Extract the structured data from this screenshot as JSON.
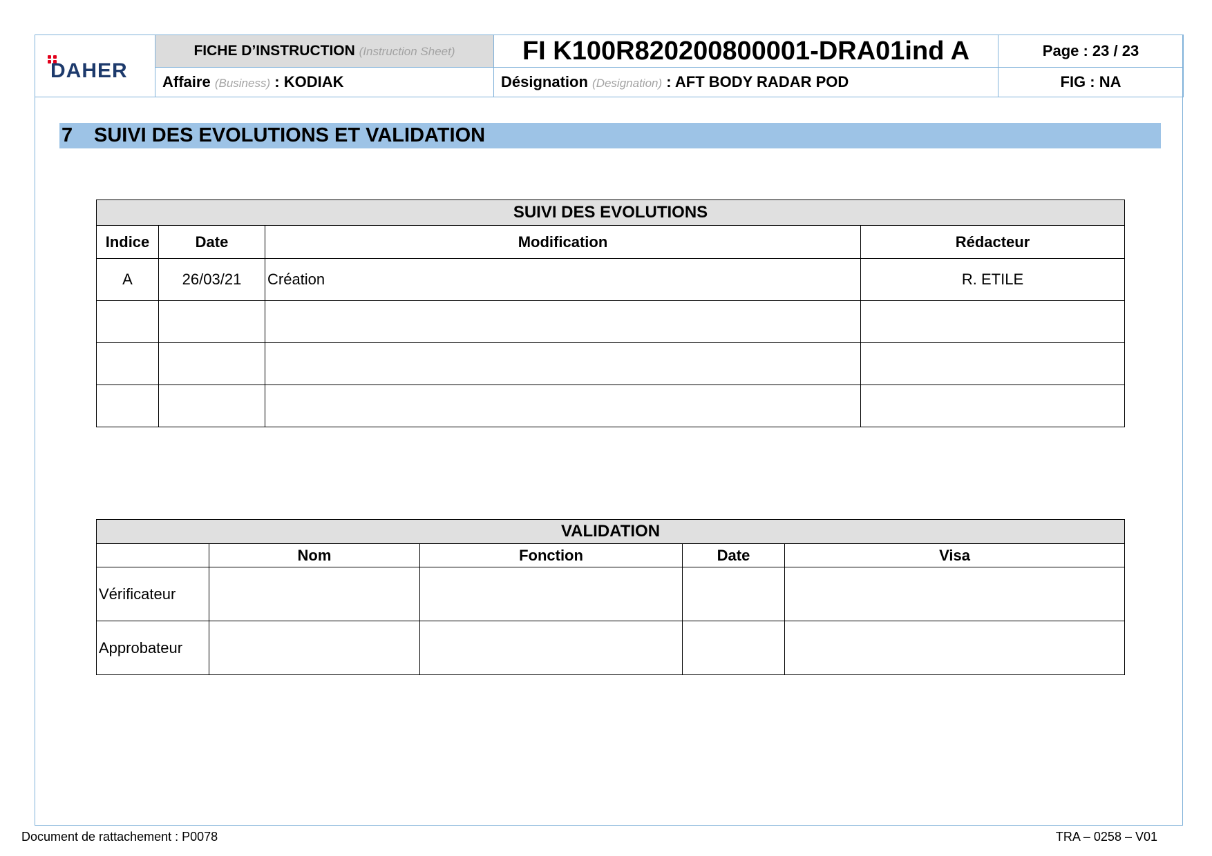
{
  "header": {
    "logo_text": "DAHER",
    "sheet_label": "FICHE D’INSTRUCTION",
    "sheet_label_en": "(Instruction Sheet)",
    "document_ref": "FI K100R820200800001-DRA01ind A",
    "page": "Page : 23 / 23",
    "affaire_label": "Affaire",
    "affaire_label_en": "(Business)",
    "affaire_value": ": KODIAK",
    "designation_label": "Désignation",
    "designation_label_en": "(Designation)",
    "designation_value": ":  AFT BODY RADAR POD",
    "fig": "FIG : NA"
  },
  "section": {
    "number": "7",
    "title": "SUIVI DES EVOLUTIONS ET VALIDATION"
  },
  "evolutions": {
    "title": "SUIVI DES EVOLUTIONS",
    "columns": [
      "Indice",
      "Date",
      "Modification",
      "Rédacteur"
    ],
    "rows": [
      [
        "A",
        "26/03/21",
        "Création",
        "R. ETILE"
      ],
      [
        "",
        "",
        "",
        ""
      ],
      [
        "",
        "",
        "",
        ""
      ],
      [
        "",
        "",
        "",
        ""
      ]
    ]
  },
  "validation": {
    "title": "VALIDATION",
    "columns": [
      "",
      "Nom",
      "Fonction",
      "Date",
      "Visa"
    ],
    "rows": [
      [
        "Vérificateur",
        "",
        "",
        "",
        ""
      ],
      [
        "Approbateur",
        "",
        "",
        "",
        ""
      ]
    ]
  },
  "footer": {
    "left": "Document de rattachement : P0078",
    "right": "TRA – 0258 – V01"
  }
}
